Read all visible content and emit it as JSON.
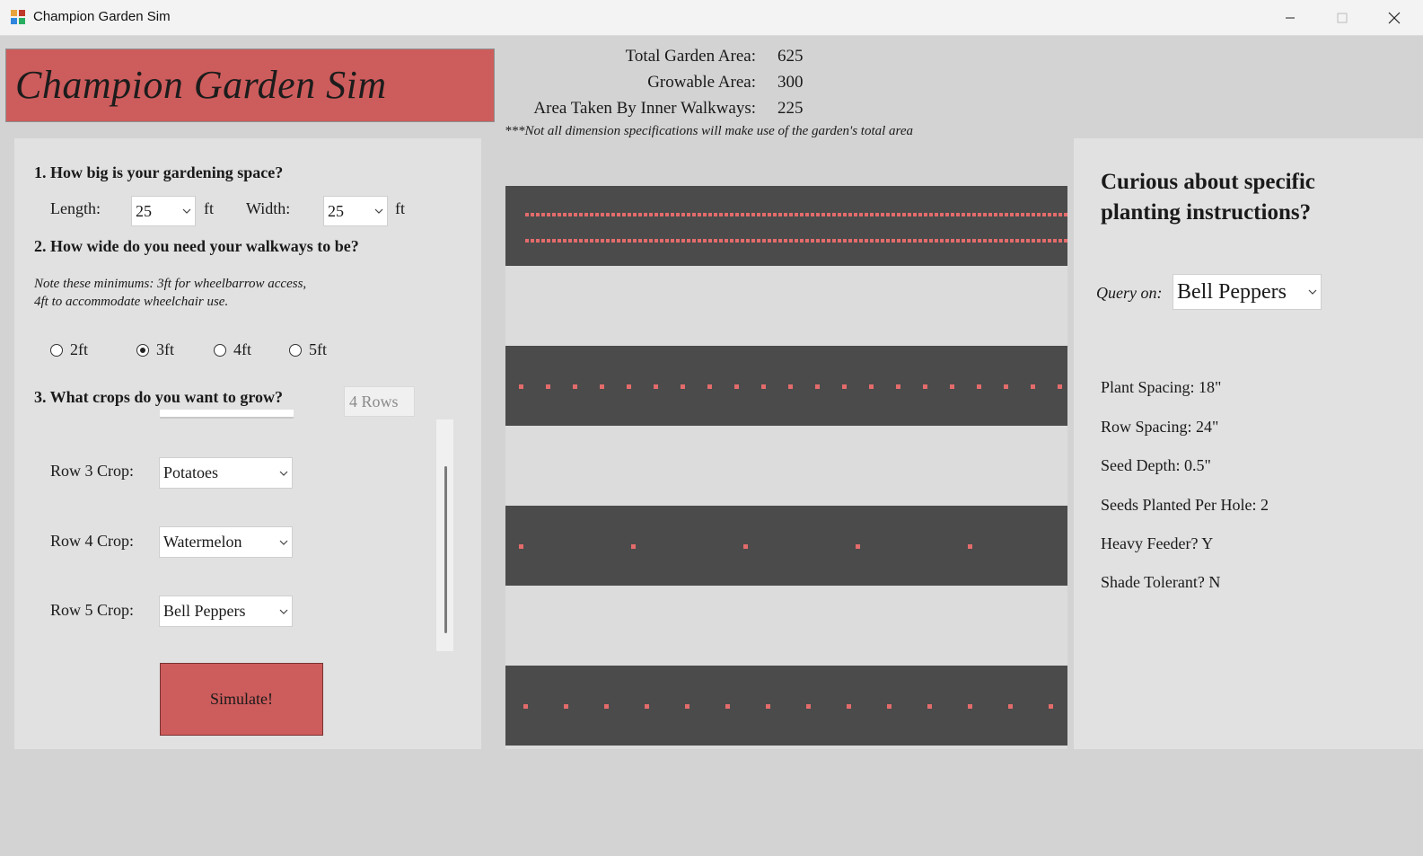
{
  "window": {
    "title": "Champion Garden Sim"
  },
  "header": {
    "title": "Champion Garden Sim"
  },
  "stats": {
    "total_label": "Total Garden Area:",
    "total_value": "625",
    "growable_label": "Growable Area:",
    "growable_value": "300",
    "walkways_label": "Area Taken By Inner Walkways:",
    "walkways_value": "225",
    "note": "***Not all dimension specifications will make use of the garden's total area"
  },
  "form": {
    "q1": "1. How big is your gardening space?",
    "length_label": "Length:",
    "length_value": "25",
    "width_label": "Width:",
    "width_value": "25",
    "unit": "ft",
    "q2": "2. How wide do you need your walkways to be?",
    "note_line1": "Note these minimums: 3ft for wheelbarrow access,",
    "note_line2": "4ft to accommodate wheelchair use.",
    "walkway_options": [
      "2ft",
      "3ft",
      "4ft",
      "5ft"
    ],
    "walkway_selected": "3ft",
    "q3": "3. What crops do you want to grow?",
    "rows_value": "4 Rows",
    "row3_label": "Row 3 Crop:",
    "row3_value": "Potatoes",
    "row4_label": "Row 4 Crop:",
    "row4_value": "Watermelon",
    "row5_label": "Row 5 Crop:",
    "row5_value": "Bell Peppers",
    "simulate_label": "Simulate!"
  },
  "garden": {
    "beds": 4,
    "plant_color": "#e46b6b",
    "bed_color": "#4b4b4b",
    "walkway_color": "#dcdcdc"
  },
  "info": {
    "heading_line1": "Curious about specific",
    "heading_line2": "planting instructions?",
    "query_label": "Query on:",
    "query_value": "Bell Peppers",
    "plant_spacing": "Plant Spacing: 18\"",
    "row_spacing": "Row Spacing: 24\"",
    "seed_depth": "Seed Depth: 0.5\"",
    "seeds_per_hole": "Seeds Planted Per Hole: 2",
    "heavy_feeder": "Heavy Feeder? Y",
    "shade_tolerant": "Shade Tolerant? N"
  },
  "icons": {
    "app": "app-icon",
    "minimize": "minimize-icon",
    "maximize": "maximize-icon",
    "close": "close-icon",
    "dropdown": "chevron-down-icon"
  }
}
